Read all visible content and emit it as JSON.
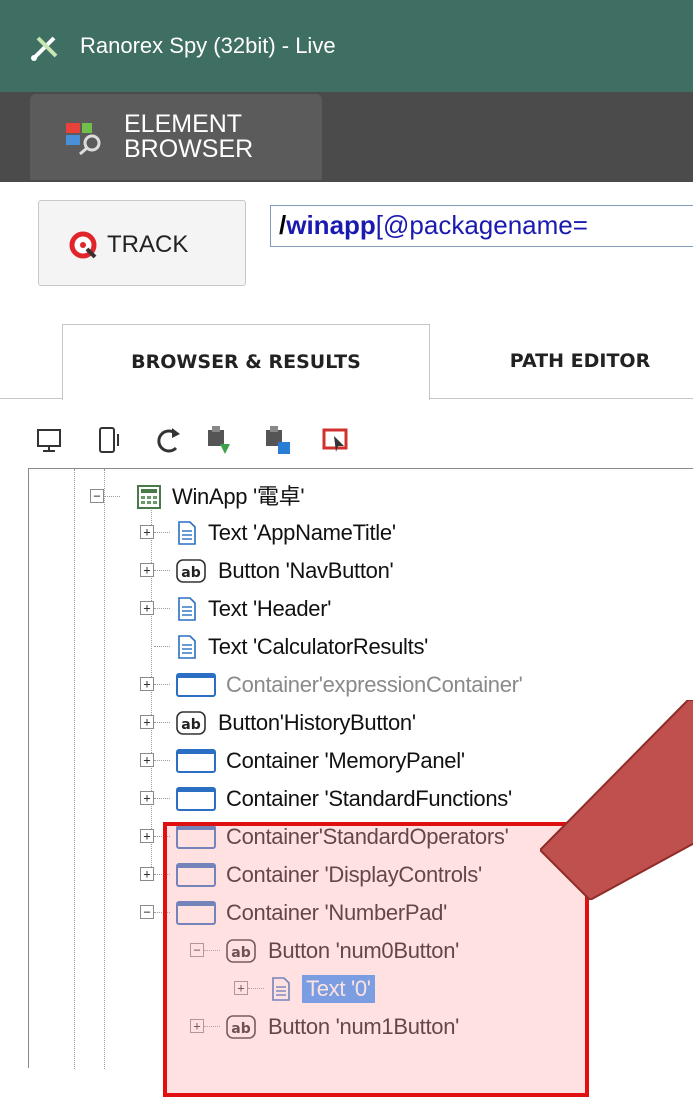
{
  "window": {
    "title": "Ranorex Spy (32bit) - Live",
    "title_icon": "ranorex-spy-icon"
  },
  "ribbon": {
    "tab_label": "ELEMENT\nBROWSER",
    "tab_icon": "element-browser-icon"
  },
  "track": {
    "label": "TRACK",
    "icon": "track-target-icon"
  },
  "path": {
    "slash": "/",
    "node": "winapp",
    "rest": "[@packagename="
  },
  "tabs": {
    "browser_results": "BROWSER & RESULTS",
    "path_editor": "PATH EDITOR"
  },
  "toolbar": {
    "icons": [
      "monitor-icon",
      "mobile-device-icon",
      "refresh-icon",
      "export-snapshot-icon",
      "save-snapshot-icon",
      "highlight-element-icon"
    ]
  },
  "tree": {
    "root": {
      "label": "WinApp '電卓'",
      "icon": "calculator-app-icon",
      "expanded": true
    },
    "items": [
      {
        "label": "Text 'AppNameTitle'",
        "icon": "text-icon",
        "expander": "+"
      },
      {
        "label": "Button 'NavButton'",
        "icon": "button-ab-icon",
        "expander": "+"
      },
      {
        "label": "Text 'Header'",
        "icon": "text-icon",
        "expander": "+"
      },
      {
        "label": "Text 'CalculatorResults'",
        "icon": "text-icon",
        "expander": ""
      },
      {
        "label": "Container'expressionContainer'",
        "icon": "container-icon",
        "expander": "+",
        "dimmed": true
      },
      {
        "label": "Button'HistoryButton'",
        "icon": "button-ab-icon",
        "expander": "+"
      },
      {
        "label": "Container 'MemoryPanel'",
        "icon": "container-icon",
        "expander": "+"
      },
      {
        "label": "Container 'StandardFunctions'",
        "icon": "container-icon",
        "expander": "+"
      },
      {
        "label": "Container'StandardOperators'",
        "icon": "container-icon",
        "expander": "+"
      },
      {
        "label": "Container 'DisplayControls'",
        "icon": "container-icon",
        "expander": "+"
      },
      {
        "label": "Container 'NumberPad'",
        "icon": "container-icon",
        "expander": "−"
      }
    ],
    "numberpad_children": [
      {
        "label": "Button 'num0Button'",
        "icon": "button-ab-icon",
        "expander": "−"
      },
      {
        "label": "Text '0'",
        "icon": "text-icon",
        "expander": "+",
        "selected": true
      },
      {
        "label": "Button 'num1Button'",
        "icon": "button-ab-icon",
        "expander": "+"
      }
    ]
  },
  "colors": {
    "title_bar": "#3f6e62",
    "ribbon": "#4b4b4b",
    "selection": "#3399ff",
    "highlight_border": "#e01010",
    "callout_arrow": "#c0504d"
  }
}
